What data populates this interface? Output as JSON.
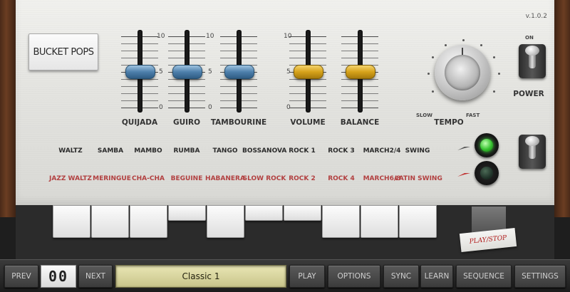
{
  "version": "v.1.0.2",
  "preset_button": "BUCKET POPS",
  "faders": [
    {
      "label": "QUIJADA",
      "value": 5,
      "color": "#4d7fab",
      "tick_top": "10",
      "tick_mid": "5",
      "tick_bot": "0"
    },
    {
      "label": "GUIRO",
      "value": 5,
      "color": "#4d7fab",
      "tick_top": "10",
      "tick_mid": "5",
      "tick_bot": "0"
    },
    {
      "label": "TAMBOURINE",
      "value": 5,
      "color": "#4d7fab",
      "tick_top": "10",
      "tick_mid": "5",
      "tick_bot": "0"
    },
    {
      "label": "VOLUME",
      "value": 5,
      "color": "#d6a21a",
      "tick_top": "10",
      "tick_mid": "5",
      "tick_bot": "0"
    },
    {
      "label": "BALANCE",
      "value": 5,
      "color": "#d6a21a"
    }
  ],
  "tempo": {
    "label": "TEMPO",
    "slow": "SLOW",
    "fast": "FAST"
  },
  "power": {
    "label": "POWER",
    "on": "ON"
  },
  "rhythms_row1": [
    "WALTZ",
    "SAMBA",
    "MAMBO",
    "RUMBA",
    "TANGO",
    "BOSSANOVA",
    "ROCK 1",
    "ROCK 3",
    "MARCH2/4",
    "SWING"
  ],
  "rhythms_row2": [
    "JAZZ WALTZ",
    "MERINGUE",
    "CHA-CHA",
    "BEGUINE",
    "HABANERA",
    "SLOW ROCK",
    "ROCK 2",
    "ROCK 4",
    "MARCH6/8",
    "LATIN SWING"
  ],
  "rhythms_row1_color": "#2b2b2b",
  "rhythms_row2_color": "#b24040",
  "play_stop_label": "PLAY/STOP",
  "toolbar": {
    "prev": "PREV",
    "counter": "00",
    "next": "NEXT",
    "display": "Classic 1",
    "play": "PLAY",
    "options": "OPTIONS",
    "sync": "SYNC",
    "learn": "LEARN",
    "sequence": "SEQUENCE",
    "settings": "SETTINGS"
  }
}
